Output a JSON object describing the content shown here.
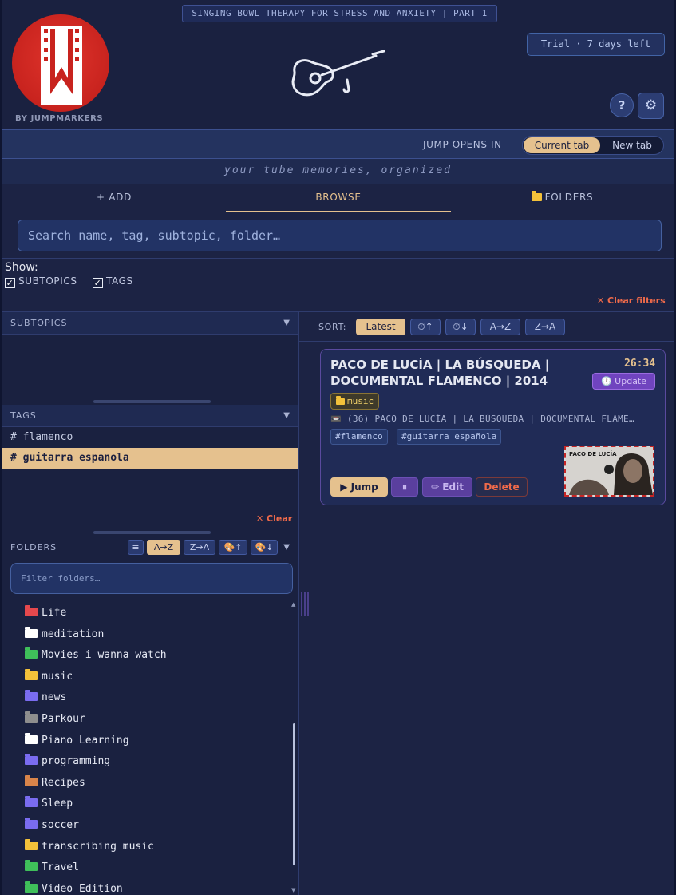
{
  "header": {
    "video_title": "SINGING BOWL THERAPY FOR STRESS AND ANXIETY | PART 1",
    "logo_sub": "BY JUMPMARKERS",
    "trial": "Trial · 7 days left",
    "help": "?",
    "settings_icon": "gear-icon"
  },
  "jump": {
    "label": "JUMP OPENS IN",
    "current_tab": "Current tab",
    "new_tab": "New tab"
  },
  "tagline": "your tube memories, organized",
  "tabs": {
    "add": "+ ADD",
    "browse": "BROWSE",
    "folders": "FOLDERS"
  },
  "search": {
    "placeholder": "Search name, tag, subtopic, folder…"
  },
  "show": {
    "label": "Show:",
    "subtopics": "SUBTOPICS",
    "tags": "TAGS",
    "clear_filters": "✕ Clear filters"
  },
  "left": {
    "subtopics_header": "SUBTOPICS",
    "tags_header": "TAGS",
    "tags": [
      {
        "label": "# flamenco",
        "selected": false
      },
      {
        "label": "# guitarra española",
        "selected": true
      }
    ],
    "clear_tags": "✕ Clear",
    "folders_header": "FOLDERS",
    "folder_sort": [
      "≡",
      "A→Z",
      "Z→A",
      "🎨↑",
      "🎨↓"
    ],
    "folder_filter_placeholder": "Filter folders…",
    "folders": [
      {
        "name": "Life",
        "color": "#e5484d"
      },
      {
        "name": "meditation",
        "color": "#ffffff"
      },
      {
        "name": "Movies i wanna watch",
        "color": "#3fbf5a"
      },
      {
        "name": "music",
        "color": "#f3c13a"
      },
      {
        "name": "news",
        "color": "#7a6cf0"
      },
      {
        "name": "Parkour",
        "color": "#8e8e8e"
      },
      {
        "name": "Piano Learning",
        "color": "#ffffff"
      },
      {
        "name": "programming",
        "color": "#7a6cf0"
      },
      {
        "name": "Recipes",
        "color": "#d9844a"
      },
      {
        "name": "Sleep",
        "color": "#7a6cf0"
      },
      {
        "name": "soccer",
        "color": "#7a6cf0"
      },
      {
        "name": "transcribing music",
        "color": "#f3c13a"
      },
      {
        "name": "Travel",
        "color": "#3fbf5a"
      },
      {
        "name": "Video Edition",
        "color": "#3fbf5a"
      }
    ]
  },
  "sort": {
    "label": "SORT:",
    "options": [
      "Latest",
      "⏱↑",
      "⏱↓",
      "A→Z",
      "Z→A"
    ],
    "active": "Latest"
  },
  "card": {
    "title": "PACO DE LUCÍA | LA BÚSQUEDA | DOCUMENTAL FLAMENCO | 2014",
    "duration": "26:34",
    "update": "🕐 Update",
    "folder": "music",
    "video_line": "📼 (36) PACO DE LUCÍA | LA BÚSQUEDA | DOCUMENTAL FLAME…",
    "tags": [
      "#flamenco",
      "#guitarra española"
    ],
    "thumb_text": "PACO DE LUCÍA",
    "jump": "▶ Jump",
    "pause": "⏸",
    "edit": "✏ Edit",
    "delete": "Delete"
  },
  "colors": {
    "accent": "#e5c18e",
    "danger": "#ef6a4a",
    "purple": "#7044bf"
  }
}
